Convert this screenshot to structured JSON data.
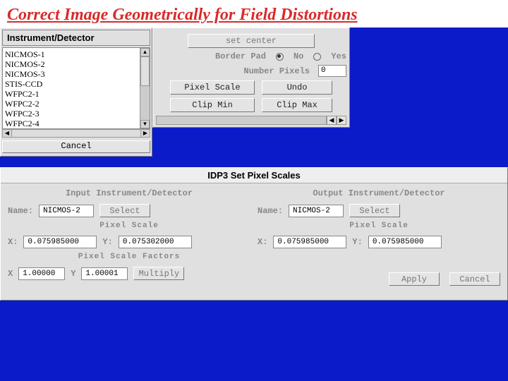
{
  "title": "Correct Image Geometrically for Field Distortions",
  "inst": {
    "header": "Instrument/Detector",
    "items": [
      "NICMOS-1",
      "NICMOS-2",
      "NICMOS-3",
      "STIS-CCD",
      "WFPC2-1",
      "WFPC2-2",
      "WFPC2-3",
      "WFPC2-4"
    ],
    "cancel": "Cancel"
  },
  "right": {
    "set_center": "set center",
    "border_pad": "Border Pad",
    "no": "No",
    "yes": "Yes",
    "num_pixels": "Number Pixels",
    "num_val": "0",
    "pixel_scale": "Pixel Scale",
    "undo": "Undo",
    "clip_min": "Clip Min",
    "clip_max": "Clip Max"
  },
  "dlg": {
    "title": "IDP3 Set Pixel Scales",
    "in_head": "Input Instrument/Detector",
    "out_head": "Output Instrument/Detector",
    "name": "Name:",
    "select": "Select",
    "in_name": "NICMOS-2",
    "out_name": "NICMOS-2",
    "ps_lbl": "Pixel Scale",
    "x": "X:",
    "y": "Y:",
    "in_x": "0.075985000",
    "in_y": "0.075302000",
    "out_x": "0.075985000",
    "out_y": "0.075985000",
    "psf_lbl": "Pixel Scale Factors",
    "fx": "X",
    "fy": "Y",
    "fx_val": "1.00000",
    "fy_val": "1.00001",
    "multiply": "Multiply",
    "apply": "Apply",
    "cancel": "Cancel"
  }
}
